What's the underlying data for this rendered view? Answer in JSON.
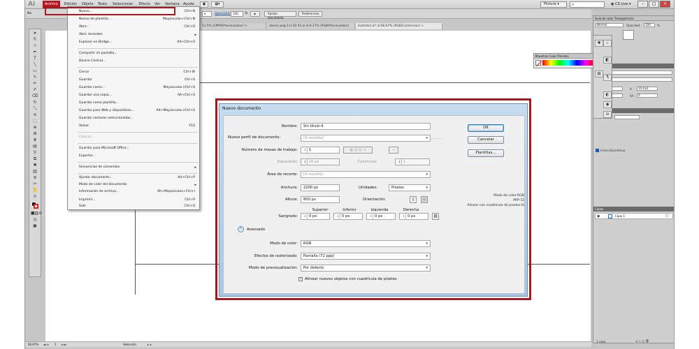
{
  "app": {
    "logo": "Ai",
    "menus": [
      "Archivo",
      "Edición",
      "Objeto",
      "Texto",
      "Seleccionar",
      "Efecto",
      "Ver",
      "Ventana",
      "Ayuda"
    ],
    "workspace": "Pintura",
    "cs_live": "CS Live"
  },
  "controlbar": {
    "label_no": "No",
    "stroke_weight": "Oval 2 pt.",
    "style_label": "Estilo:",
    "opacity_label": "Opacidad:",
    "opacity_value": "100",
    "opacity_unit": "%",
    "adjust_button": "Ajustar documento",
    "prefs_button": "Preferencias"
  },
  "tabs": [
    "12.5% (CMYK/Previsualizar)",
    "diseno pag 2 ls 02 01.ai al 6.17% (RGB/Previsualizar)",
    "ilustrator.ai* al 66.67% (RGB/Contornear)"
  ],
  "file_menu": {
    "items": [
      {
        "label": "Nuevo...",
        "shortcut": "Ctrl+N"
      },
      {
        "label": "Nuevo de plantilla...",
        "shortcut": "Mayúsculas+Ctrl+N"
      },
      {
        "label": "Abrir...",
        "shortcut": "Ctrl+O"
      },
      {
        "label": "Abrir recientes",
        "shortcut": ""
      },
      {
        "label": "Explorar en Bridge...",
        "shortcut": "Alt+Ctrl+O"
      },
      {
        "label": "Compartir mi pantalla...",
        "shortcut": ""
      },
      {
        "label": "Device Central...",
        "shortcut": ""
      },
      {
        "label": "Cerrar",
        "shortcut": "Ctrl+W"
      },
      {
        "label": "Guardar",
        "shortcut": "Ctrl+S"
      },
      {
        "label": "Guardar como...",
        "shortcut": "Mayúsculas+Ctrl+S"
      },
      {
        "label": "Guardar una copia...",
        "shortcut": "Alt+Ctrl+S"
      },
      {
        "label": "Guardar como plantilla...",
        "shortcut": ""
      },
      {
        "label": "Guardar para Web y dispositivos...",
        "shortcut": "Alt+Mayúsculas+Ctrl+S"
      },
      {
        "label": "Guardar sectores seleccionados...",
        "shortcut": ""
      },
      {
        "label": "Volver",
        "shortcut": "F12"
      },
      {
        "label": "Colocar...",
        "shortcut": ""
      },
      {
        "label": "Guardar para Microsoft Office...",
        "shortcut": ""
      },
      {
        "label": "Exportar...",
        "shortcut": ""
      },
      {
        "label": "Secuencias de comandos",
        "shortcut": ""
      },
      {
        "label": "Ajustar documento...",
        "shortcut": "Alt+Ctrl+P"
      },
      {
        "label": "Modo de color del documento",
        "shortcut": ""
      },
      {
        "label": "Información de archivo...",
        "shortcut": "Alt+Mayúsculas+Ctrl+I"
      },
      {
        "label": "Imprimir...",
        "shortcut": "Ctrl+P"
      },
      {
        "label": "Salir",
        "shortcut": "Ctrl+Q"
      }
    ]
  },
  "dialog": {
    "title": "Nuevo documento",
    "name_label": "Nombre:",
    "name_value": "Sin título-4",
    "profile_label": "Nuevo perfil de documento:",
    "profile_value": "[A medida]",
    "artboards_label": "Número de mesas de trabajo:",
    "artboards_value": "1",
    "spacing_label": "Espaciado:",
    "spacing_value": "20 px",
    "columns_label": "Columnas:",
    "columns_value": "1",
    "size_label": "Área de recorte:",
    "size_value": "[A medida]",
    "width_label": "Anchura:",
    "width_value": "2200 px",
    "units_label": "Unidades:",
    "units_value": "Píxeles",
    "height_label": "Altura:",
    "height_value": "800 px",
    "orientation_label": "Orientación:",
    "bleed_top": "Superior",
    "bleed_bottom": "Inferior",
    "bleed_left": "Izquierda",
    "bleed_right": "Derecha",
    "bleed_label": "Sangrado:",
    "bleed_values": [
      "0 px",
      "0 px",
      "0 px",
      "0 px"
    ],
    "advanced_label": "Avanzado",
    "color_mode_label": "Modo de color:",
    "color_mode_value": "RGB",
    "raster_label": "Efectos de rasterizado:",
    "raster_value": "Pantalla (72 ppp)",
    "preview_label": "Modo de previsualización:",
    "preview_value": "Por defecto",
    "align_checkbox": "Alinear nuevos objetos con cuadrícula de píxeles",
    "ok": "OK",
    "cancel": "Cancelar",
    "templates": "Plantillas...",
    "info_line1": "Modo de color:RGB",
    "info_line2": "PPP:72",
    "info_line3": "Alinear con cuadrícula de píxeles:Sí"
  },
  "panels": {
    "transparency_tabs": "Guía de color  Transparencia",
    "blend_mode": "Normal",
    "opacity_label": "Opacidad:",
    "opacity_value": "100",
    "opacity_unit": "%",
    "color_tabs": "Muestras  Color  Pinceles",
    "character_title": "Carácter",
    "font_family": "Myriad Pro",
    "font_style": "Regular",
    "font_size": "12 pt",
    "leading": "14.4 pt",
    "kerning": "Auto",
    "tracking": "0",
    "stroke_title": "Trazo",
    "stroke_weight_label": "Grosor:",
    "dash_label": "Línea discontinua",
    "layers_title": "Capas",
    "layer_name": "Capa 1",
    "layers_count": "1 capa"
  },
  "status": {
    "zoom": "66.67%",
    "page": "1",
    "tool": "Selección"
  }
}
